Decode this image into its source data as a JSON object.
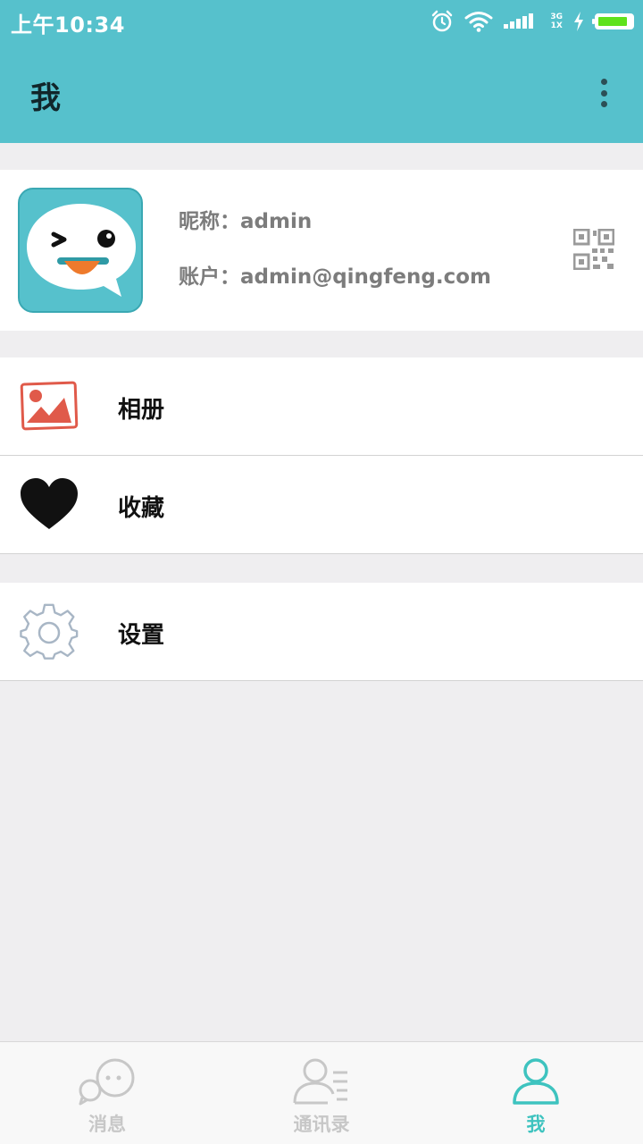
{
  "status_bar": {
    "time": "上午10:34",
    "network": "3G",
    "network_sub": "1X",
    "icons": [
      "alarm-icon",
      "wifi-icon",
      "signal-icon",
      "charging-icon",
      "battery-icon"
    ]
  },
  "app_bar": {
    "title": "我",
    "menu_icon": "more-vertical-icon"
  },
  "profile": {
    "nickname_label": "昵称：",
    "nickname": "admin",
    "account_label": "账户：",
    "account": "admin@qingfeng.com",
    "avatar_icon": "winking-chat-bubble-avatar",
    "qr_icon": "qr-code-icon"
  },
  "menu": {
    "album": {
      "label": "相册",
      "icon": "photo-album-icon"
    },
    "favorites": {
      "label": "收藏",
      "icon": "heart-icon"
    },
    "settings": {
      "label": "设置",
      "icon": "gear-icon"
    }
  },
  "bottom_nav": {
    "items": [
      {
        "label": "消息",
        "icon": "chat-bubbles-icon",
        "active": false
      },
      {
        "label": "通讯录",
        "icon": "contacts-icon",
        "active": false
      },
      {
        "label": "我",
        "icon": "person-icon",
        "active": true
      }
    ]
  },
  "colors": {
    "primary": "#56c1cc",
    "active_tab": "#3ec3bf",
    "inactive_tab": "#c7c7c7",
    "background": "#efeef0"
  }
}
